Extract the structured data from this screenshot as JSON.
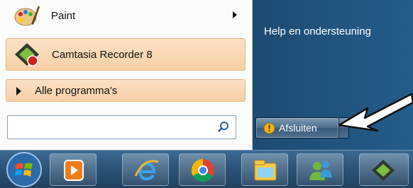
{
  "start_menu": {
    "programs": [
      {
        "label": "Paint",
        "icon": "paint-icon",
        "has_submenu": true
      },
      {
        "label": "Camtasia Recorder 8",
        "icon": "camtasia-recorder-icon",
        "has_submenu": false
      }
    ],
    "all_programs_label": "Alle programma's",
    "search": {
      "value": "",
      "placeholder": ""
    },
    "right_pane": {
      "help_link": "Help en ondersteuning"
    },
    "shutdown": {
      "label": "Afsluiten"
    }
  },
  "taskbar": {
    "buttons": [
      {
        "icon": "windows-start-orb-icon"
      },
      {
        "icon": "media-player-icon"
      },
      {
        "icon": "internet-explorer-icon"
      },
      {
        "icon": "chrome-icon"
      },
      {
        "icon": "windows-explorer-icon"
      },
      {
        "icon": "people-icon"
      },
      {
        "icon": "camtasia-icon"
      }
    ]
  },
  "colors": {
    "highlight": "#f7cfa6",
    "menu_background": "#fbfbfb",
    "taskbar": "#2c5478",
    "annotation_arrow": "#ffffff"
  }
}
